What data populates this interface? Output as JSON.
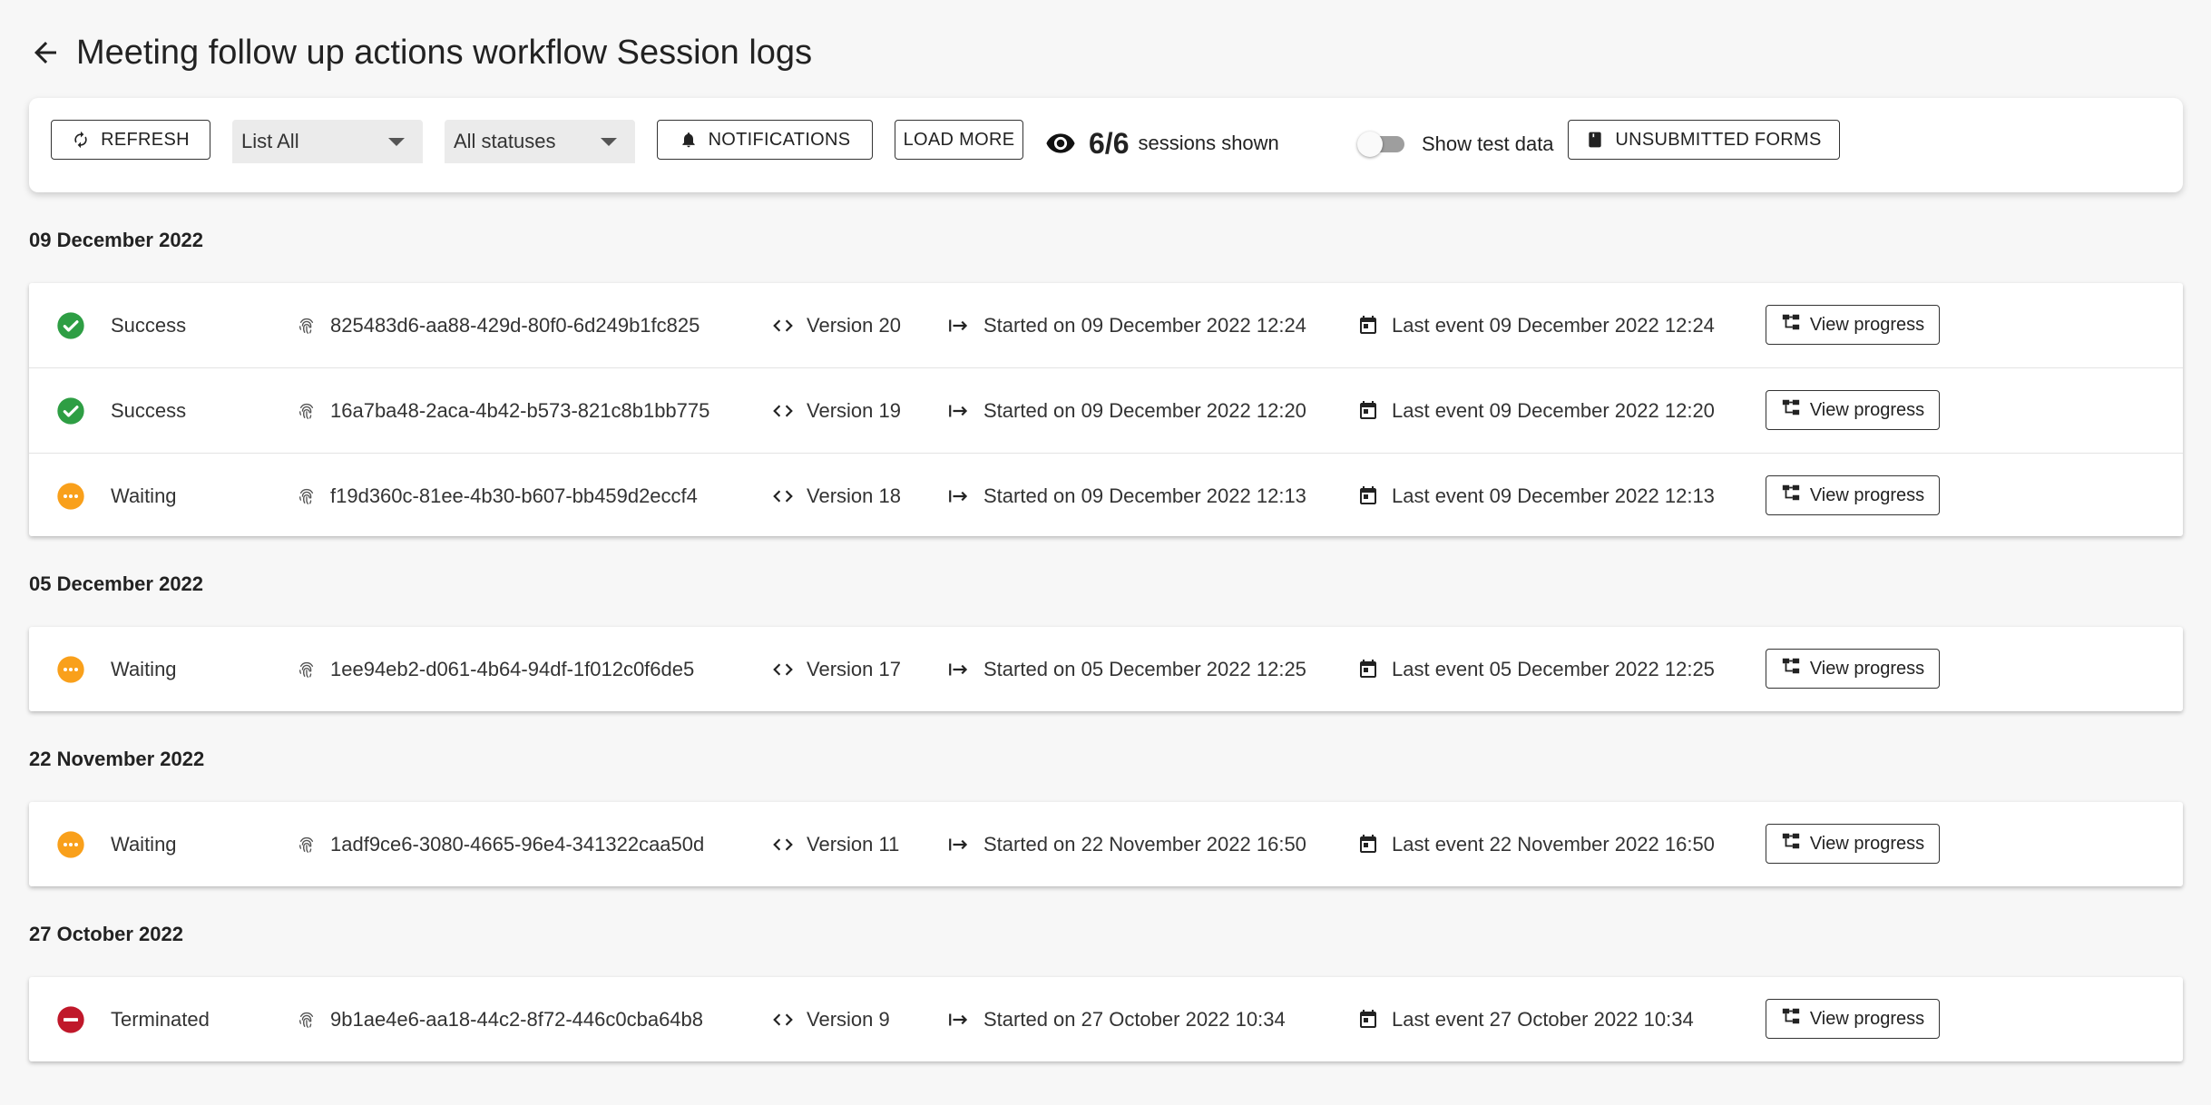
{
  "header": {
    "title": "Meeting follow up actions workflow Session logs"
  },
  "toolbar": {
    "refresh_label": "REFRESH",
    "list_select": "List All",
    "status_select": "All statuses",
    "notifications_label": "NOTIFICATIONS",
    "load_more_label": "LOAD MORE",
    "sessions_count": "6/6",
    "sessions_shown_label": "sessions shown",
    "test_data_label": "Show test data",
    "test_data_enabled": false,
    "unsubmitted_label": "UNSUBMITTED FORMS"
  },
  "colors": {
    "success": "#2e9e44",
    "waiting": "#f9a01b",
    "terminated": "#c0182a"
  },
  "groups": [
    {
      "date": "09 December 2022",
      "sessions": [
        {
          "status": "Success",
          "status_type": "success",
          "id": "825483d6-aa88-429d-80f0-6d249b1fc825",
          "version": "Version 20",
          "started": "Started on 09 December 2022 12:24",
          "last_event": "Last event 09 December 2022 12:24",
          "action": "View progress"
        },
        {
          "status": "Success",
          "status_type": "success",
          "id": "16a7ba48-2aca-4b42-b573-821c8b1bb775",
          "version": "Version 19",
          "started": "Started on 09 December 2022 12:20",
          "last_event": "Last event 09 December 2022 12:20",
          "action": "View progress"
        },
        {
          "status": "Waiting",
          "status_type": "waiting",
          "id": "f19d360c-81ee-4b30-b607-bb459d2eccf4",
          "version": "Version 18",
          "started": "Started on 09 December 2022 12:13",
          "last_event": "Last event 09 December 2022 12:13",
          "action": "View progress"
        }
      ]
    },
    {
      "date": "05 December 2022",
      "sessions": [
        {
          "status": "Waiting",
          "status_type": "waiting",
          "id": "1ee94eb2-d061-4b64-94df-1f012c0f6de5",
          "version": "Version 17",
          "started": "Started on 05 December 2022 12:25",
          "last_event": "Last event 05 December 2022 12:25",
          "action": "View progress"
        }
      ]
    },
    {
      "date": "22 November 2022",
      "sessions": [
        {
          "status": "Waiting",
          "status_type": "waiting",
          "id": "1adf9ce6-3080-4665-96e4-341322caa50d",
          "version": "Version 11",
          "started": "Started on 22 November 2022 16:50",
          "last_event": "Last event 22 November 2022 16:50",
          "action": "View progress"
        }
      ]
    },
    {
      "date": "27 October 2022",
      "sessions": [
        {
          "status": "Terminated",
          "status_type": "terminated",
          "id": "9b1ae4e6-aa18-44c2-8f72-446c0cba64b8",
          "version": "Version 9",
          "started": "Started on 27 October 2022 10:34",
          "last_event": "Last event 27 October 2022 10:34",
          "action": "View progress"
        }
      ]
    }
  ]
}
